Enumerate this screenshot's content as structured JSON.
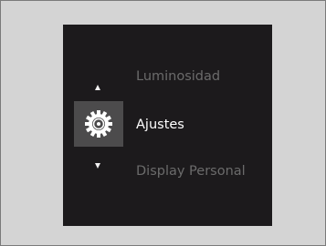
{
  "menu": {
    "previous_item": "Luminosidad",
    "current_item": "Ajustes",
    "next_item": "Display Personal",
    "current_icon": "gear-icon"
  },
  "colors": {
    "screen_background": "#1c1a1c",
    "selected_tile": "#4c4b4c",
    "selected_text": "#ffffff",
    "dim_text": "#6b6b6b"
  }
}
